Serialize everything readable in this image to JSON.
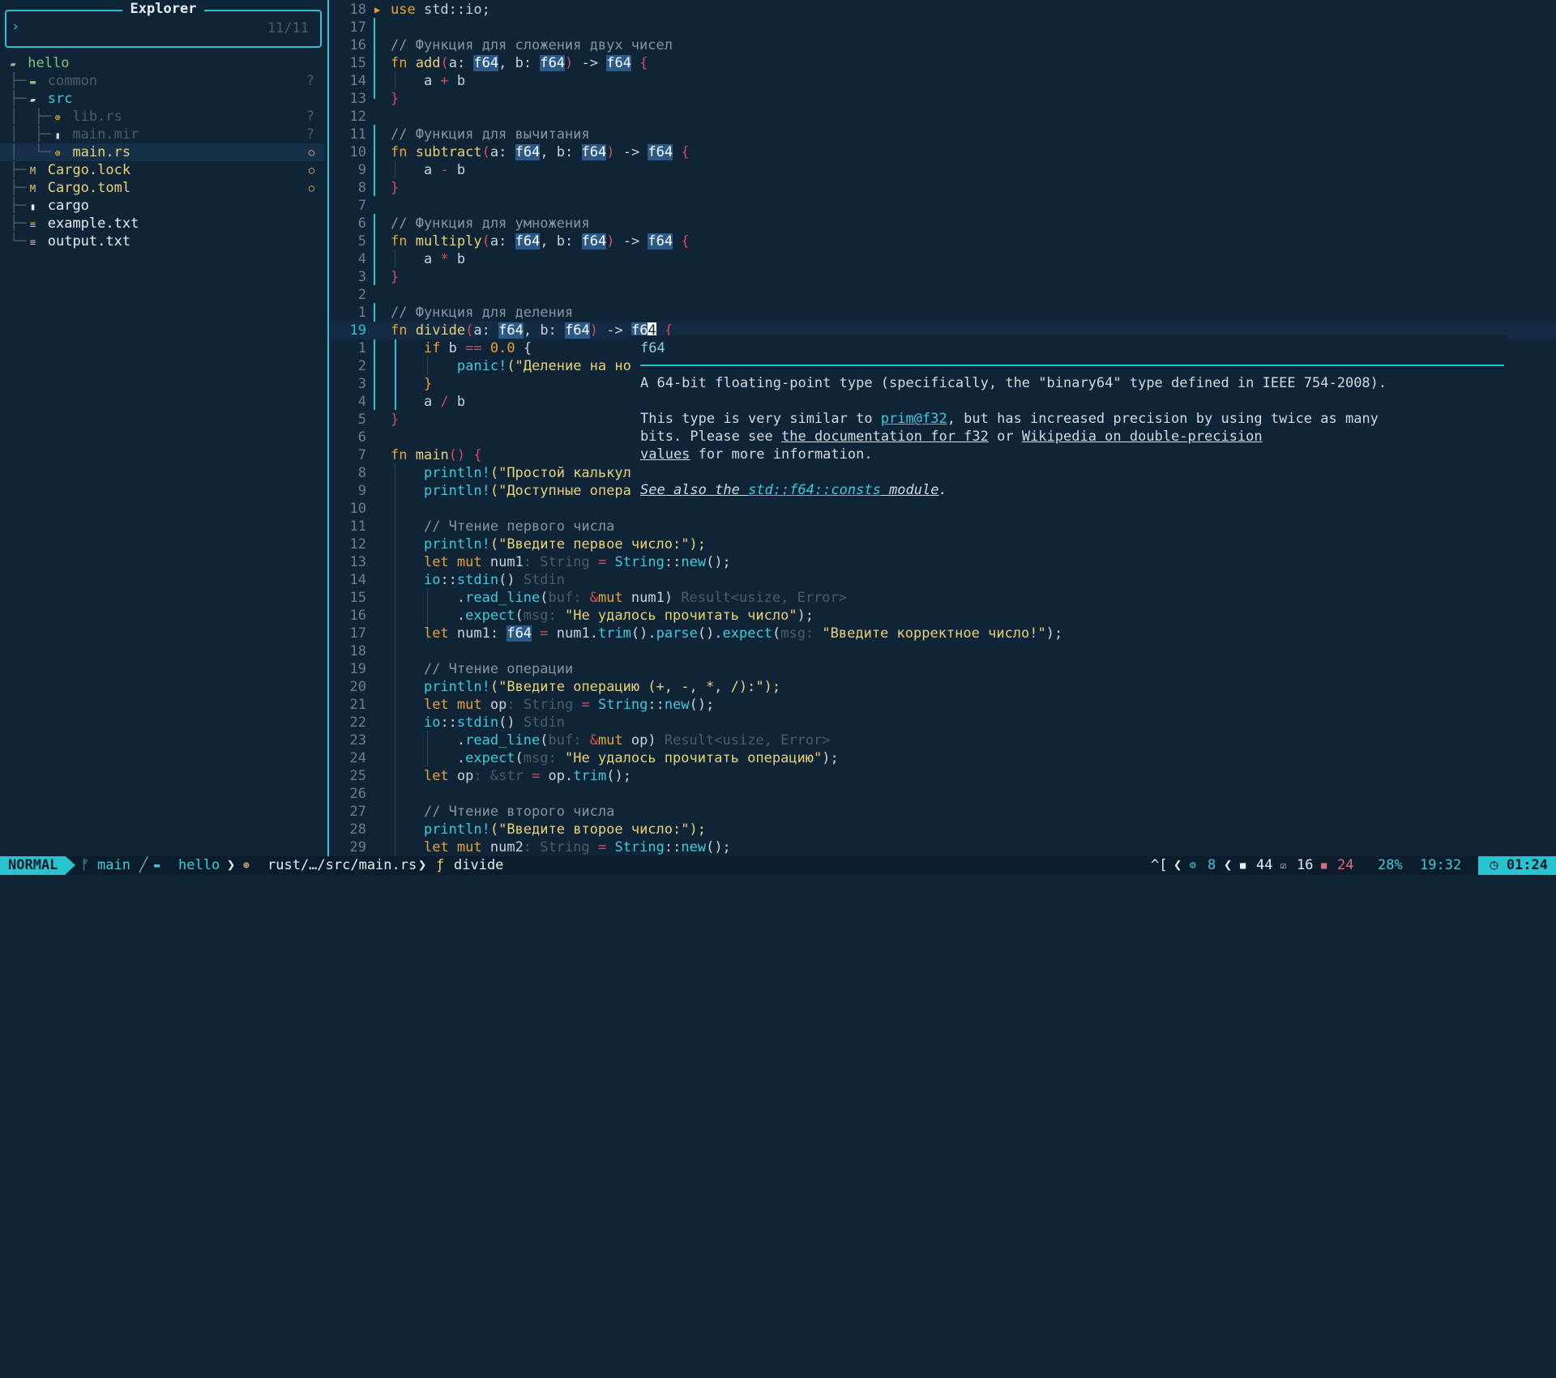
{
  "explorer": {
    "title": "Explorer",
    "prompt": "›",
    "count": "11/11",
    "items": [
      {
        "label": "hello"
      },
      {
        "label": "common",
        "status": "?"
      },
      {
        "label": "src"
      },
      {
        "label": "lib.rs",
        "status": "?"
      },
      {
        "label": "main.mir",
        "status": "?"
      },
      {
        "label": "main.rs",
        "status": "○"
      },
      {
        "label": "Cargo.lock",
        "status": "○"
      },
      {
        "label": "Cargo.toml",
        "status": "○"
      },
      {
        "label": "cargo"
      },
      {
        "label": "example.txt"
      },
      {
        "label": "output.txt"
      }
    ]
  },
  "editor": {
    "line_numbers": [
      "18",
      "17",
      "16",
      "15",
      "14",
      "13",
      "12",
      "11",
      "10",
      "9",
      "8",
      "7",
      "6",
      "5",
      "4",
      "3",
      "2",
      "1",
      "19",
      "1",
      "2",
      "3",
      "4",
      "5",
      "6",
      "7",
      "8",
      "9",
      "10",
      "11",
      "12",
      "13",
      "14",
      "15",
      "16",
      "17",
      "18",
      "19",
      "20",
      "21",
      "22",
      "23",
      "24",
      "25",
      "26",
      "27",
      "28",
      "29"
    ],
    "code": {
      "l0_use": "use",
      "l0_rest": " std::io;",
      "cm_add": "// Функция для сложения двух чисел",
      "fn_add": "add",
      "cm_sub": "// Функция для вычитания",
      "fn_sub": "subtract",
      "cm_mul": "// Функция для умножения",
      "fn_mul": "multiply",
      "cm_div": "// Функция для деления",
      "fn_div": "divide",
      "panic_str": "(\"Деление на но",
      "main_fn": "main",
      "pl_1": "(\"Простой калькул",
      "pl_2": "(\"Доступные опера",
      "cm_read1": "// Чтение первого числа",
      "str_first": "(\"Введите первое число:\");",
      "num1": "num1",
      "str_fail_num": "\"Не удалось прочитать число\"",
      "str_correct": "\"Введите корректное число!\"",
      "cm_readop": "// Чтение операции",
      "str_op": "(\"Введите операцию (+, -, *, /):\");",
      "op": "op",
      "str_fail_op": "\"Не удалось прочитать операцию\"",
      "cm_read2": "// Чтение второго числа",
      "str_second": "(\"Введите второе число:\");",
      "num2": "num2"
    }
  },
  "hover": {
    "signature": "f64",
    "p1": "A 64-bit floating-point type (specifically, the \"binary64\" type defined in IEEE 754-2008).",
    "p2a": "This type is very similar to ",
    "p2_link": "prim@f32",
    "p2b": ", but has increased precision by using twice as many",
    "p3a": "bits. Please see ",
    "p3_link1": "the documentation for f32",
    "p3b": " or ",
    "p3_link2": "Wikipedia on double-precision",
    "p4_link": "values",
    "p4b": " for more information.",
    "p5a": "See also the ",
    "p5_link": "std::f64::consts",
    "p5b": " module",
    "p5c": "."
  },
  "statusline": {
    "mode": "NORMAL",
    "branch": "main",
    "project": "hello",
    "path": "rust/…/src/main.rs",
    "symbol": "divide",
    "keys": "^[",
    "hints": "8",
    "lsp_ok": "44",
    "lsp_check": "16",
    "lsp_err": "24",
    "percent": "28%",
    "position": "19:32",
    "time": "01:24"
  },
  "colors": {
    "accent": "#29c2cf",
    "background": "#0f2436",
    "keyword": "#e8a23a",
    "function": "#e8d27a",
    "bracket": "#d94a5a"
  }
}
